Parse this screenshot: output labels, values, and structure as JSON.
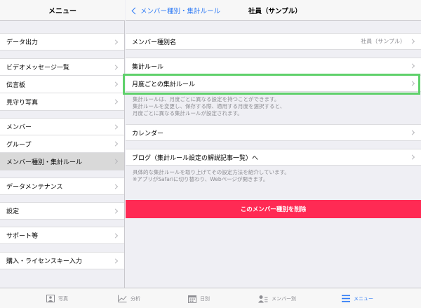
{
  "sidebar": {
    "title": "メニュー",
    "items": [
      {
        "label": "データ出力"
      },
      {
        "label": "ビデオメッセージ一覧"
      },
      {
        "label": "伝言板"
      },
      {
        "label": "見守り写真"
      },
      {
        "label": "メンバー"
      },
      {
        "label": "グループ"
      },
      {
        "label": "メンバー種別・集計ルール"
      },
      {
        "label": "データメンテナンス"
      },
      {
        "label": "設定"
      },
      {
        "label": "サポート等"
      },
      {
        "label": "購入・ライセンスキー入力"
      }
    ]
  },
  "nav": {
    "back_label": "メンバー種別・集計ルール",
    "title": "社員（サンプル）"
  },
  "detail": {
    "member_type_label": "メンバー種別名",
    "member_type_value": "社員（サンプル）",
    "rule_label": "集計ルール",
    "monthly_rule_label": "月度ごとの集計ルール",
    "monthly_note": "集計ルールは、月度ごとに異なる設定を持つことができます。\n集計ルールを変更し、保存する際、適用する月度を選択すると、\n月度ごとに異なる集計ルールが設定されます。",
    "calendar_label": "カレンダー",
    "blog_label": "ブログ（集計ルール設定の解説記事一覧）へ",
    "blog_note": "具体的な集計ルールを取り上げてその設定方法を紹介しています。\n※アプリがSafariに切り替わり、Webページが開きます。",
    "delete_label": "このメンバー種別を削除"
  },
  "tabs": [
    {
      "label": "写真",
      "icon": "photo-icon"
    },
    {
      "label": "分析",
      "icon": "chart-icon"
    },
    {
      "label": "日別",
      "icon": "calendar-icon"
    },
    {
      "label": "メンバー別",
      "icon": "member-icon"
    },
    {
      "label": "メニュー",
      "icon": "menu-icon"
    }
  ],
  "colors": {
    "accent": "#2f7bf6",
    "danger": "#ff2a54",
    "highlight": "#5fd16b"
  }
}
